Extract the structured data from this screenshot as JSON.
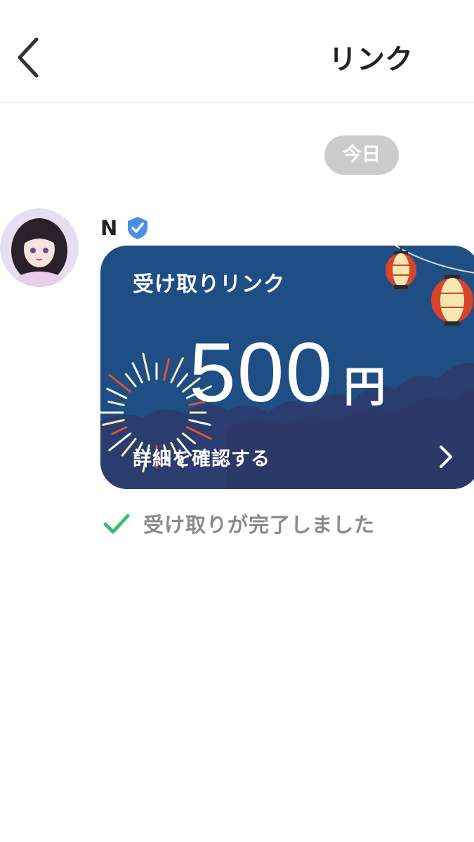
{
  "header": {
    "title": "リンク"
  },
  "chat": {
    "date_label": "今日",
    "message": {
      "sender_name": "N",
      "card": {
        "label": "受け取りリンク",
        "amount": "500",
        "currency": "円",
        "detail_label": "詳細を確認する"
      },
      "status": "受け取りが完了しました"
    }
  },
  "colors": {
    "card_background": "#1f4e85",
    "status_check": "#3dbb6c",
    "verified_badge": "#4a90e2",
    "date_pill": "#cccccc"
  },
  "icons": [
    "back-arrow-icon",
    "verified-badge-icon",
    "lantern-icon",
    "fireworks-icon",
    "chevron-right-icon",
    "check-icon"
  ]
}
